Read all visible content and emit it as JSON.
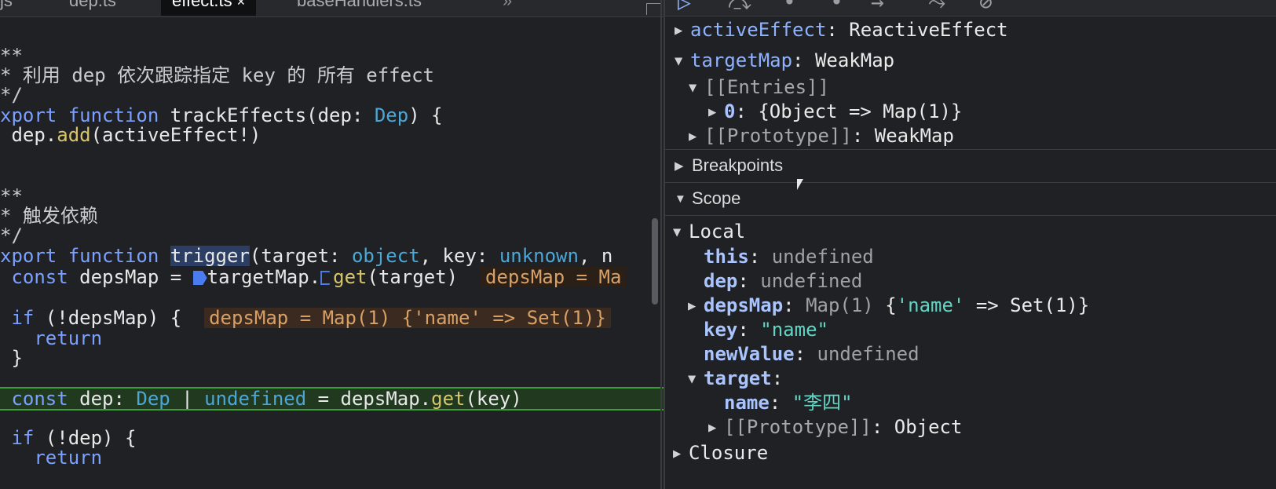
{
  "editor": {
    "tabs": [
      {
        "label": "js"
      },
      {
        "label": "dep.ts"
      },
      {
        "label": "effect.ts",
        "close": "×"
      },
      {
        "label": "baseHandlers.ts"
      }
    ],
    "overflow": "»",
    "lines": {
      "l1": "**",
      "l2": "* 利用 dep 依次跟踪指定 key 的 所有 effect",
      "l3": "*/",
      "l4a": "xport",
      "l4b": " function ",
      "l4c": "trackEffects",
      "l4d": "(dep: ",
      "l4e": "Dep",
      "l4f": ") {",
      "l5a": " dep.",
      "l5b": "add",
      "l5c": "(activeEffect!)",
      "l6": "**",
      "l7": "* 触发依赖",
      "l8": "*/",
      "l9a": "xport",
      "l9b": " function ",
      "l9c": "trigger",
      "l9d": "(target: ",
      "l9e": "object",
      "l9f": ", key: ",
      "l9g": "unknown",
      "l9h": ", n",
      "l10a": " const",
      "l10b": " depsMap = ",
      "l10c": "targetMap.",
      "l10d": "get",
      "l10e": "(target)",
      "l10f": "depsMap = Ma",
      "l11a": " if",
      "l11b": " (!depsMap) {",
      "l11c": "depsMap = Map(1) {'name' => Set(1)}",
      "l12": "   return",
      "l13": " }",
      "l14a": " const",
      "l14b": " dep: ",
      "l14c": "Dep",
      "l14d": " | ",
      "l14e": "undefined",
      "l14f": " = depsMap.",
      "l14g": "get",
      "l14h": "(key)",
      "l15a": " if",
      "l15b": " (!dep) {",
      "l16": "   return"
    }
  },
  "debugger": {
    "watch": {
      "activeEffect_key": "activeEffect",
      "activeEffect_val": "ReactiveEffect",
      "targetMap_key": "targetMap",
      "targetMap_val": "WeakMap",
      "entries": "[[Entries]]",
      "entry0_key": "0",
      "entry0_val": "{Object => Map(1)}",
      "proto_key": "[[Prototype]]",
      "proto_val": "WeakMap"
    },
    "sections": {
      "breakpoints": "Breakpoints",
      "scope": "Scope"
    },
    "scope": {
      "local": "Local",
      "this_key": "this",
      "this_val": "undefined",
      "dep_key": "dep",
      "dep_val": "undefined",
      "depsMap_key": "depsMap",
      "depsMap_val1": "Map(1) ",
      "depsMap_val2": "{",
      "depsMap_val3": "'name'",
      "depsMap_val4": " => Set(1)}",
      "key_key": "key",
      "key_val": "\"name\"",
      "newValue_key": "newValue",
      "newValue_val": "undefined",
      "target_key": "target",
      "name_key": "name",
      "name_val": "\"李四\"",
      "tproto_key": "[[Prototype]]",
      "tproto_val": "Object",
      "closure": "Closure"
    }
  },
  "colors": {
    "keyword": "#7ca0ff",
    "type": "#4aa8d8",
    "method": "#d6c66b",
    "string": "#61d6c4",
    "exec_line": "#213a1f"
  }
}
